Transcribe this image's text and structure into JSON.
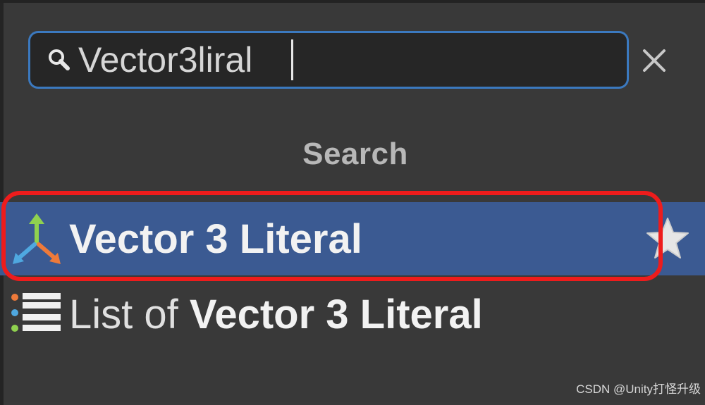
{
  "search": {
    "value": "Vector3liral",
    "icon": "search-icon",
    "clear_icon": "close-icon"
  },
  "section_title": "Search",
  "results": [
    {
      "label": "Vector 3 Literal",
      "icon": "vector3-axes-icon",
      "selected": true,
      "favorite_icon": "star-icon"
    },
    {
      "label_prefix": "List of ",
      "label_main": "Vector 3 Literal",
      "icon": "list-icon",
      "selected": false
    }
  ],
  "colors": {
    "selection": "#3b5a92",
    "focus_border": "#3b79bf",
    "highlight_outline": "#ee1c1c"
  },
  "watermark": "CSDN @Unity打怪升级"
}
